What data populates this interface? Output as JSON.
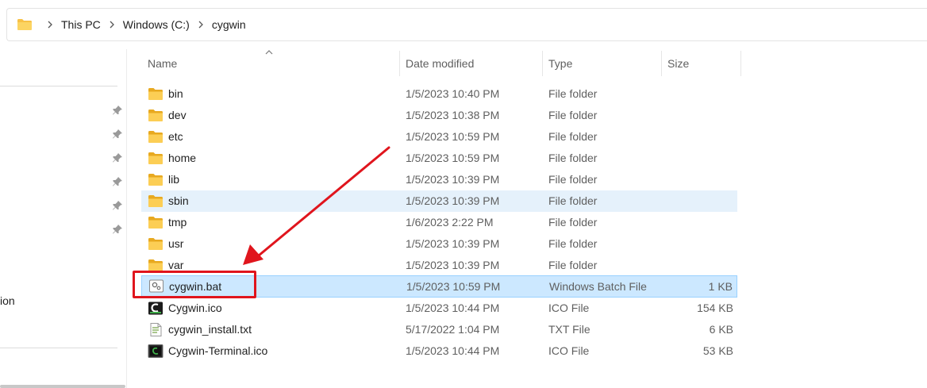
{
  "address": {
    "crumbs": [
      "This PC",
      "Windows (C:)",
      "cygwin"
    ],
    "icon": "folder-icon"
  },
  "nav": {
    "partial_label": "ion",
    "pin_icon": "pin-icon"
  },
  "columns": {
    "name": "Name",
    "date": "Date modified",
    "type": "Type",
    "size": "Size",
    "sort": "ascending-by-name"
  },
  "files": [
    {
      "name": "bin",
      "date": "1/5/2023 10:40 PM",
      "type": "File folder",
      "size": "",
      "icon": "folder-icon"
    },
    {
      "name": "dev",
      "date": "1/5/2023 10:38 PM",
      "type": "File folder",
      "size": "",
      "icon": "folder-icon"
    },
    {
      "name": "etc",
      "date": "1/5/2023 10:59 PM",
      "type": "File folder",
      "size": "",
      "icon": "folder-icon"
    },
    {
      "name": "home",
      "date": "1/5/2023 10:59 PM",
      "type": "File folder",
      "size": "",
      "icon": "folder-icon"
    },
    {
      "name": "lib",
      "date": "1/5/2023 10:39 PM",
      "type": "File folder",
      "size": "",
      "icon": "folder-icon"
    },
    {
      "name": "sbin",
      "date": "1/5/2023 10:39 PM",
      "type": "File folder",
      "size": "",
      "icon": "folder-icon"
    },
    {
      "name": "tmp",
      "date": "1/6/2023 2:22 PM",
      "type": "File folder",
      "size": "",
      "icon": "folder-icon"
    },
    {
      "name": "usr",
      "date": "1/5/2023 10:39 PM",
      "type": "File folder",
      "size": "",
      "icon": "folder-icon"
    },
    {
      "name": "var",
      "date": "1/5/2023 10:39 PM",
      "type": "File folder",
      "size": "",
      "icon": "folder-icon"
    },
    {
      "name": "cygwin.bat",
      "date": "1/5/2023 10:59 PM",
      "type": "Windows Batch File",
      "size": "1 KB",
      "icon": "batch-file-icon"
    },
    {
      "name": "Cygwin.ico",
      "date": "1/5/2023 10:44 PM",
      "type": "ICO File",
      "size": "154 KB",
      "icon": "cygwin-logo-icon"
    },
    {
      "name": "cygwin_install.txt",
      "date": "5/17/2022 1:04 PM",
      "type": "TXT File",
      "size": "6 KB",
      "icon": "text-file-icon"
    },
    {
      "name": "Cygwin-Terminal.ico",
      "date": "1/5/2023 10:44 PM",
      "type": "ICO File",
      "size": "53 KB",
      "icon": "terminal-icon"
    }
  ],
  "state": {
    "hover_row": "sbin",
    "selected_row": "cygwin.bat",
    "annotation_target": "cygwin.bat"
  },
  "colors": {
    "hover": "#e5f1fb",
    "selected": "#cce8ff",
    "annotation": "#e0151d",
    "folder": "#f8c146"
  }
}
